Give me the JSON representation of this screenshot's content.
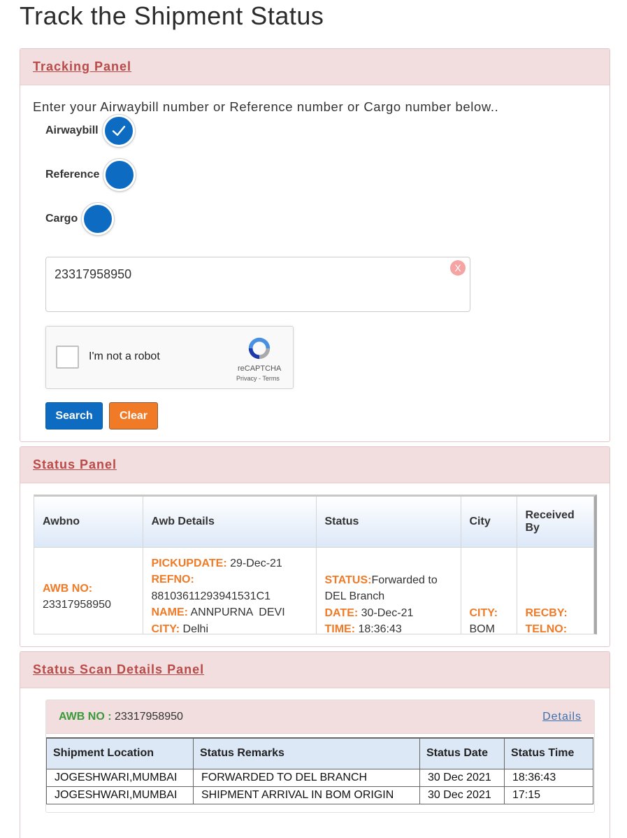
{
  "page": {
    "title": "Track the Shipment Status"
  },
  "tracking_panel": {
    "heading": "Tracking Panel",
    "intro": "Enter your Airwaybill number or Reference number or Cargo number below..",
    "radios": [
      {
        "label": "Airwaybill",
        "checked": true
      },
      {
        "label": "Reference",
        "checked": false
      },
      {
        "label": "Cargo",
        "checked": false
      }
    ],
    "input_value": "23317958950",
    "clear_x": "X",
    "captcha": {
      "label": "I'm not a robot",
      "brand": "reCAPTCHA",
      "terms": "Privacy - Terms"
    },
    "search_label": "Search",
    "clear_label": "Clear"
  },
  "status_panel": {
    "heading": "Status Panel",
    "columns": [
      "Awbno",
      "Awb Details",
      "Status",
      "City",
      "Received By"
    ],
    "row": {
      "awb_label": "AWB NO:",
      "awb_value": "23317958950",
      "pickup_label": "PICKUPDATE:",
      "pickup_value": "29-Dec-21",
      "refno_label": "REFNO:",
      "refno_value": "88103611293941531C1",
      "name_label": "NAME:",
      "name_value": "ANNPURNA  DEVI",
      "city_label": "CITY:",
      "city_value": "Delhi",
      "status_label": "STATUS:",
      "status_value": "Forwarded to DEL Branch",
      "date_label": "DATE:",
      "date_value": "30-Dec-21",
      "time_label": "TIME:",
      "time_value": "18:36:43",
      "city2_label": "CITY:",
      "city2_value": "BOM",
      "recby_label": "RECBY:",
      "telno_label": "TELNO:"
    }
  },
  "scan_panel": {
    "heading": "Status Scan Details Panel",
    "awb_label": "AWB NO :",
    "awb_value": "23317958950",
    "details_link": "Details",
    "columns": [
      "Shipment Location",
      "Status Remarks",
      "Status Date",
      "Status Time"
    ],
    "rows": [
      [
        "JOGESHWARI,MUMBAI",
        "FORWARDED TO DEL BRANCH",
        "30 Dec 2021",
        "18:36:43"
      ],
      [
        "JOGESHWARI,MUMBAI",
        "SHIPMENT ARRIVAL IN BOM ORIGIN",
        "30 Dec 2021",
        "17:15"
      ]
    ]
  },
  "colors": {
    "primary": "#0d6cc2",
    "accent": "#f07a26",
    "panel_head": "#f2dede",
    "heading_red": "#b94a48"
  }
}
